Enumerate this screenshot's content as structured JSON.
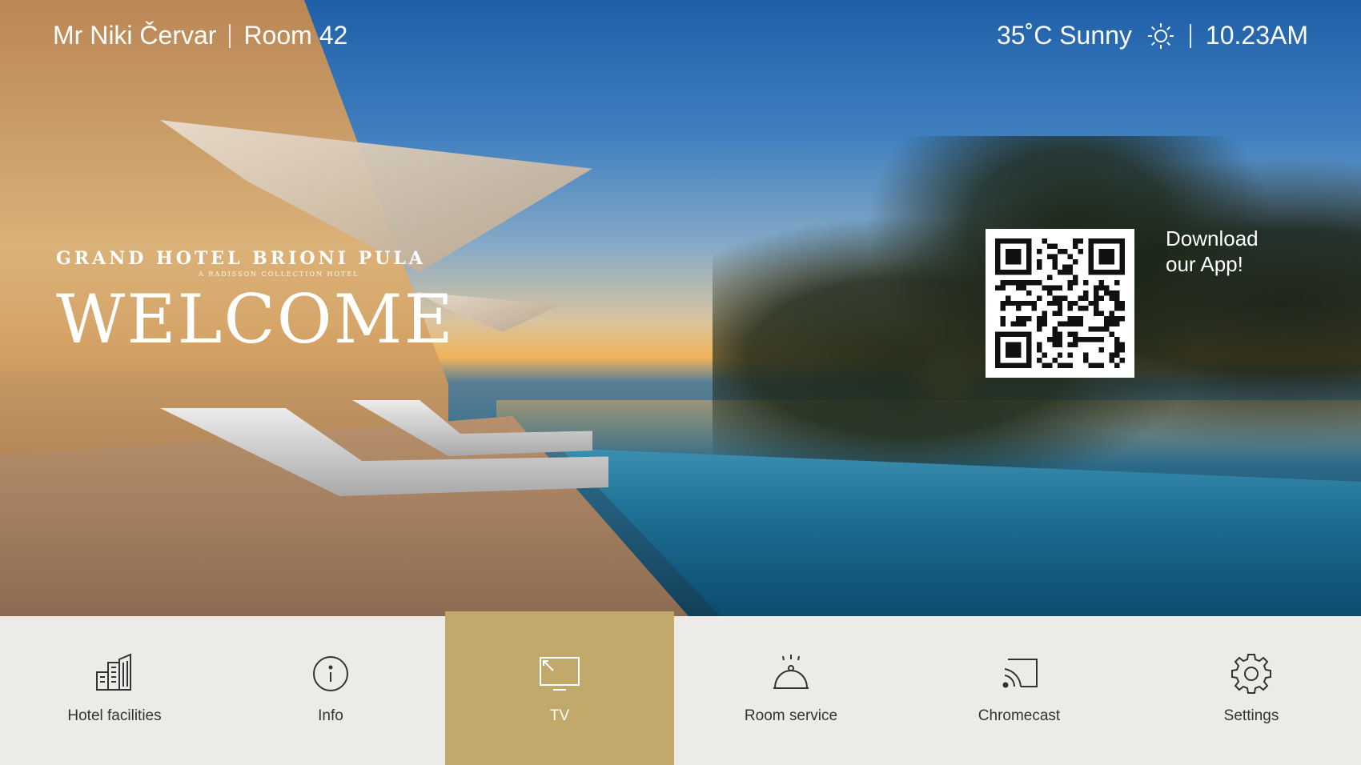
{
  "header": {
    "guest_name": "Mr Niki Červar",
    "room": "Room 42",
    "weather": "35˚C Sunny",
    "weather_icon": "sun-icon",
    "time": "10.23AM"
  },
  "brand": {
    "name": "GRAND HOTEL BRIONI PULA",
    "subtitle": "A RADISSON COLLECTION HOTEL",
    "greeting": "WELCOME"
  },
  "promo": {
    "text_line1": "Download",
    "text_line2": "our App!",
    "qr_icon": "qr-code-icon"
  },
  "nav": {
    "items": [
      {
        "label": "Hotel facilities",
        "icon": "building-icon",
        "active": false
      },
      {
        "label": "Info",
        "icon": "info-icon",
        "active": false
      },
      {
        "label": "TV",
        "icon": "tv-icon",
        "active": true
      },
      {
        "label": "Room service",
        "icon": "cloche-icon",
        "active": false
      },
      {
        "label": "Chromecast",
        "icon": "cast-icon",
        "active": false
      },
      {
        "label": "Settings",
        "icon": "gear-icon",
        "active": false
      }
    ],
    "active_color": "#c0a96a",
    "background_color": "#ecebe8"
  }
}
